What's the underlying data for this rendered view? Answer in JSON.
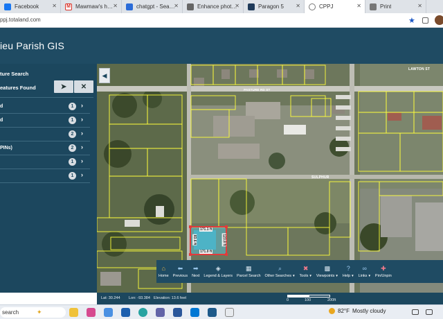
{
  "browser": {
    "tabs": [
      {
        "title": "Facebook",
        "icon_color": "#1877f2",
        "active": false
      },
      {
        "title": "Mawmaw's house",
        "icon_color": "#d93025",
        "active": false
      },
      {
        "title": "chatgpt - Search",
        "icon_color": "#2b6cd8",
        "active": false
      },
      {
        "title": "Enhance photo re",
        "icon_color": "#666666",
        "active": false
      },
      {
        "title": "Paragon 5",
        "icon_color": "#1f3a5a",
        "active": false
      },
      {
        "title": "CPPJ",
        "icon_color": "#777777",
        "active": true
      },
      {
        "title": "Print",
        "icon_color": "#777777",
        "active": false
      }
    ],
    "url": "ppj.totaland.com"
  },
  "app": {
    "title": "ieu Parish GIS"
  },
  "sidebar": {
    "section_title": "ture Search",
    "found_label": "eatures Found",
    "locate_icon": "navigation-arrow-icon",
    "clear_icon": "close-x-icon",
    "rows": [
      {
        "label": "d",
        "count": "1"
      },
      {
        "label": "d",
        "count": "1"
      },
      {
        "label": "",
        "count": "2"
      },
      {
        "label": "PINs)",
        "count": "2"
      },
      {
        "label": "",
        "count": "1"
      },
      {
        "label": "",
        "count": "1"
      }
    ]
  },
  "map": {
    "streets": [
      "PASTURE RD ST",
      "SULPHUR",
      "LAWTON ST"
    ],
    "parcel_dims": [
      "171.1 ft",
      "123.8 ft",
      "83.6 ft",
      "171.0 ft"
    ]
  },
  "toolbar": {
    "items": [
      {
        "label": "Home",
        "icon": "home-icon",
        "dropdown": false
      },
      {
        "label": "Previous",
        "icon": "arrow-left-icon",
        "dropdown": false
      },
      {
        "label": "Next",
        "icon": "arrow-right-icon",
        "dropdown": false
      },
      {
        "label": "Legend & Layers",
        "icon": "layers-icon",
        "dropdown": false
      },
      {
        "label": "Parcel Search",
        "icon": "parcel-search-icon",
        "dropdown": false
      },
      {
        "label": "Other Searches",
        "icon": "search-icon",
        "dropdown": true
      },
      {
        "label": "Tools",
        "icon": "tools-icon",
        "dropdown": true
      },
      {
        "label": "Viewpoints",
        "icon": "grid-icon",
        "dropdown": true
      },
      {
        "label": "Help",
        "icon": "help-icon",
        "dropdown": true
      },
      {
        "label": "Links",
        "icon": "link-icon",
        "dropdown": true
      },
      {
        "label": "Pin/Unpin",
        "icon": "pin-icon",
        "dropdown": false
      }
    ]
  },
  "status": {
    "lat": "Lat: 30.244",
    "lon": "Lon: -93.384",
    "elevation": "Elevation: 13.6 feet",
    "scale_0": "0",
    "scale_100": "100",
    "scale_200": "200ft"
  },
  "taskbar": {
    "search_label": "search",
    "temperature": "82°F",
    "condition": "Mostly cloudy"
  }
}
